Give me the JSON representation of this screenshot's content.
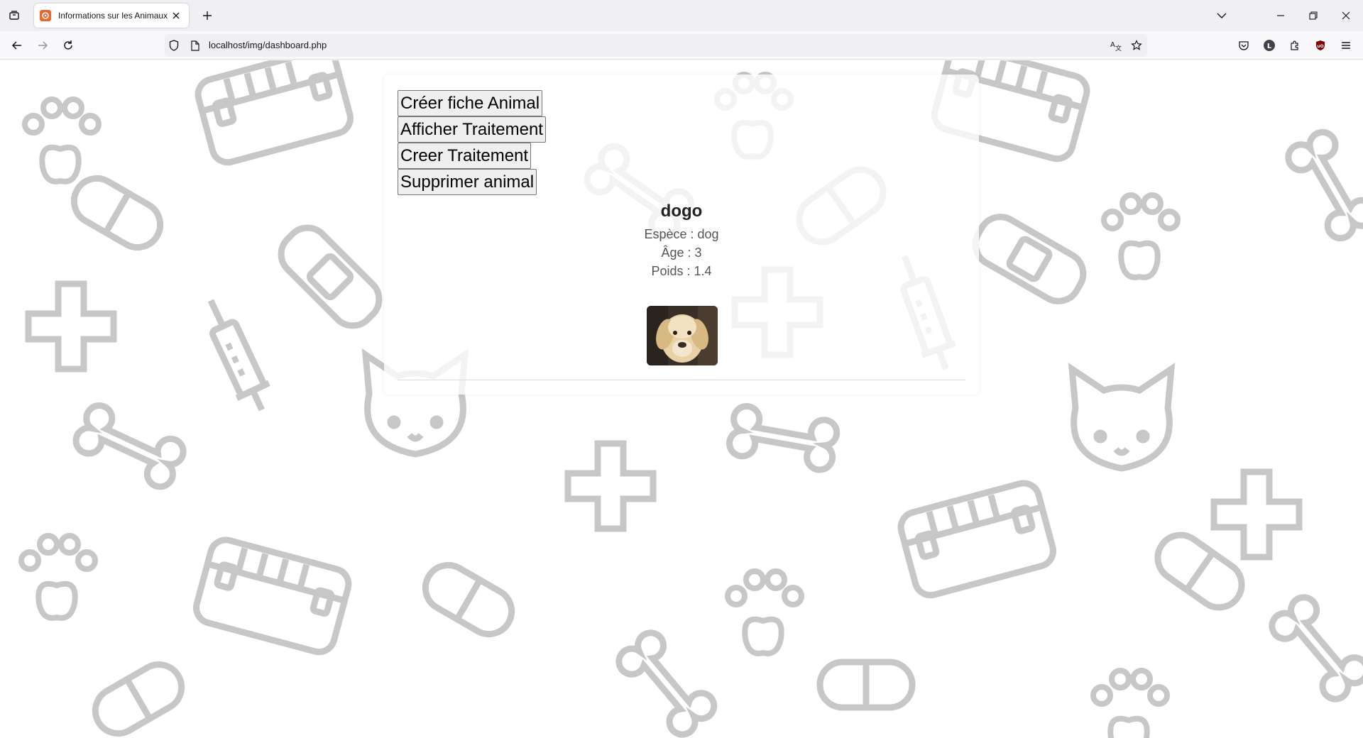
{
  "browser": {
    "tab_title": "Informations sur les Animaux",
    "url": "localhost/img/dashboard.php"
  },
  "page": {
    "buttons": [
      {
        "label": "Créer fiche Animal"
      },
      {
        "label": "Afficher Traitement"
      },
      {
        "label": "Creer Traitement"
      },
      {
        "label": "Supprimer animal"
      }
    ],
    "animal": {
      "name": "dogo",
      "species_line": "Espèce : dog",
      "age_line": "Âge : 3",
      "weight_line": "Poids : 1.4"
    }
  },
  "icons": [
    "tab-list-icon",
    "favicon-icon",
    "close-icon",
    "plus-icon",
    "chevron-down-icon",
    "minimize-icon",
    "restore-icon",
    "window-close-icon",
    "back-arrow-icon",
    "forward-arrow-icon",
    "reload-icon",
    "shield-icon",
    "page-icon",
    "translate-icon",
    "star-icon",
    "pocket-icon",
    "account-icon",
    "extensions-icon",
    "ublock-icon",
    "menu-icon"
  ]
}
